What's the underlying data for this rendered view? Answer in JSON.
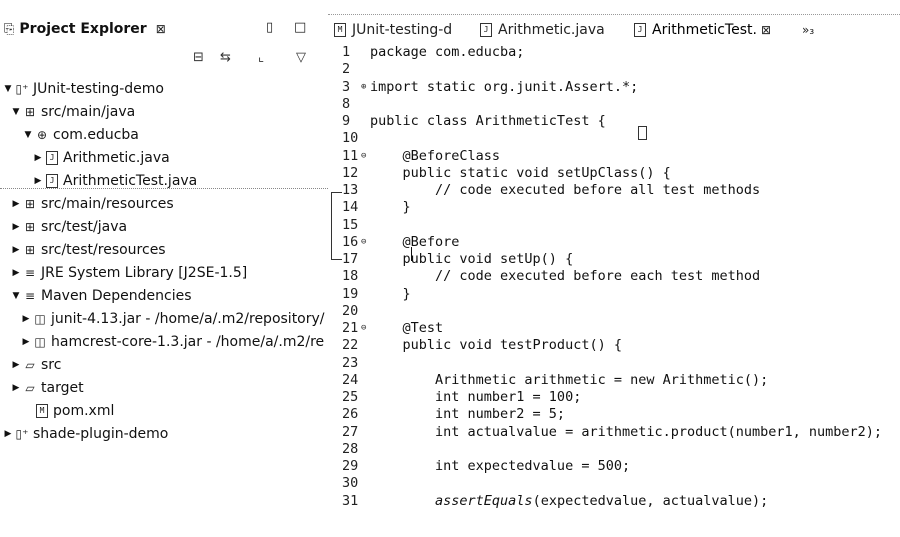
{
  "explorer": {
    "title": "Project Explorer",
    "close_glyph": "⊠",
    "minimize_glyph": "▯",
    "maximize_glyph": "□",
    "toolbar": {
      "collapse_icon": "⊟",
      "link_icon": "⇆",
      "focus_icon": "⌞",
      "menu_icon": "▽"
    },
    "tree": [
      {
        "label": "JUnit-testing-demo",
        "icon": "▯⁺",
        "twisty": "▼"
      },
      {
        "label": "src/main/java",
        "icon": "⊞",
        "twisty": "▼"
      },
      {
        "label": "com.educba",
        "icon": "⊕",
        "twisty": "▼"
      },
      {
        "label": "Arithmetic.java",
        "icon": "J",
        "twisty": "▶"
      },
      {
        "label": "ArithmeticTest.java",
        "icon": "J",
        "twisty": "▶"
      },
      {
        "label": "src/main/resources",
        "icon": "⊞",
        "twisty": "▶"
      },
      {
        "label": "src/test/java",
        "icon": "⊞",
        "twisty": "▶"
      },
      {
        "label": "src/test/resources",
        "icon": "⊞",
        "twisty": "▶"
      },
      {
        "label": "JRE System Library [J2SE-1.5]",
        "icon": "≡",
        "twisty": "▶"
      },
      {
        "label": "Maven Dependencies",
        "icon": "≡",
        "twisty": "▼"
      },
      {
        "label": "junit-4.13.jar - /home/a/.m2/repository/",
        "icon": "◫",
        "twisty": "▶"
      },
      {
        "label": "hamcrest-core-1.3.jar - /home/a/.m2/re",
        "icon": "◫",
        "twisty": "▶"
      },
      {
        "label": "src",
        "icon": "▱",
        "twisty": "▶"
      },
      {
        "label": "target",
        "icon": "▱",
        "twisty": "▶"
      },
      {
        "label": "pom.xml",
        "icon": "M",
        "twisty": ""
      },
      {
        "label": "shade-plugin-demo",
        "icon": "▯⁺",
        "twisty": "▶"
      }
    ]
  },
  "editor": {
    "tabs": [
      {
        "label": "JUnit-testing-d",
        "icon": "M"
      },
      {
        "label": "Arithmetic.java",
        "icon": "J"
      },
      {
        "label": "ArithmeticTest.",
        "icon": "J",
        "close": "⊠"
      }
    ],
    "overflow_label": "»₃",
    "lines": [
      {
        "num": "1",
        "text": "package com.educba;",
        "fold": ""
      },
      {
        "num": "2",
        "text": "",
        "fold": ""
      },
      {
        "num": "3",
        "text": "import static org.junit.Assert.*;",
        "fold": "⊕"
      },
      {
        "num": "8",
        "text": "",
        "fold": ""
      },
      {
        "num": "9",
        "text": "public class ArithmeticTest {",
        "fold": ""
      },
      {
        "num": "10",
        "text": "",
        "fold": ""
      },
      {
        "num": "11",
        "text": "    @BeforeClass",
        "fold": "⊖"
      },
      {
        "num": "12",
        "text": "    public static void setUpClass() {",
        "fold": ""
      },
      {
        "num": "13",
        "text": "        // code executed before all test methods",
        "fold": ""
      },
      {
        "num": "14",
        "text": "    }",
        "fold": ""
      },
      {
        "num": "15",
        "text": "",
        "fold": ""
      },
      {
        "num": "16",
        "text": "    @Before",
        "fold": "⊖"
      },
      {
        "num": "17",
        "text": "    public void setUp() {",
        "fold": ""
      },
      {
        "num": "18",
        "text": "        // code executed before each test method",
        "fold": ""
      },
      {
        "num": "19",
        "text": "    }",
        "fold": ""
      },
      {
        "num": "20",
        "text": "",
        "fold": ""
      },
      {
        "num": "21",
        "text": "    @Test",
        "fold": "⊖"
      },
      {
        "num": "22",
        "text": "    public void testProduct() {",
        "fold": ""
      },
      {
        "num": "23",
        "text": "",
        "fold": ""
      },
      {
        "num": "24",
        "text": "        Arithmetic arithmetic = new Arithmetic();",
        "fold": ""
      },
      {
        "num": "25",
        "text": "        int number1 = 100;",
        "fold": ""
      },
      {
        "num": "26",
        "text": "        int number2 = 5;",
        "fold": ""
      },
      {
        "num": "27",
        "text": "        int actualvalue = arithmetic.product(number1, number2);",
        "fold": ""
      },
      {
        "num": "28",
        "text": "",
        "fold": ""
      },
      {
        "num": "29",
        "text": "        int expectedvalue = 500;",
        "fold": ""
      },
      {
        "num": "30",
        "text": "",
        "fold": ""
      },
      {
        "num": "31",
        "text": "        assertEquals(expectedvalue, actualvalue);",
        "fold": "",
        "italic_prefix": "assertEquals"
      }
    ]
  }
}
